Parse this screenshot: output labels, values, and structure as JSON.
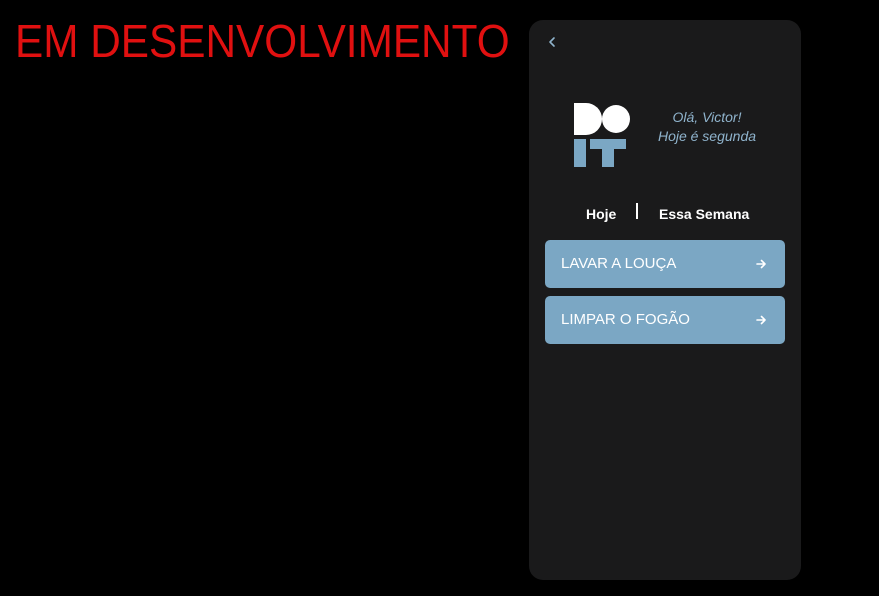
{
  "banner": {
    "text": "EM DESENVOLVIMENTO",
    "color": "#e01010"
  },
  "app": {
    "back_icon": "chevron-left-icon",
    "logo": {
      "text": "DO IT",
      "top_color": "#ffffff",
      "bottom_color": "#7ba7c4"
    },
    "greeting": {
      "line1": "Olá, Victor!",
      "line2": "Hoje é segunda"
    },
    "tabs": [
      {
        "label": "Hoje"
      },
      {
        "label": "Essa Semana"
      }
    ],
    "tasks": [
      {
        "label": "LAVAR A LOUÇA",
        "icon": "arrow-right-icon"
      },
      {
        "label": "LIMPAR O FOGÃO",
        "icon": "arrow-right-icon"
      }
    ],
    "colors": {
      "background": "#000000",
      "panel": "#1a1a1b",
      "accent": "#7ba7c4",
      "greeting": "#8fb3cc"
    }
  }
}
